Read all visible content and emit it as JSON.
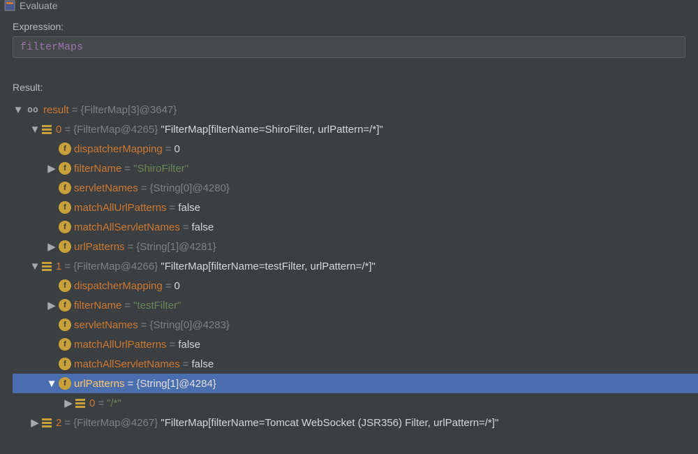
{
  "window": {
    "title": "Evaluate"
  },
  "expression": {
    "label": "Expression:",
    "value": "filterMaps"
  },
  "result": {
    "label": "Result:",
    "root": {
      "name": "result",
      "type": "{FilterMap[3]@3647}"
    },
    "items": [
      {
        "index": "0",
        "type": "{FilterMap@4265}",
        "summary": "\"FilterMap[filterName=ShiroFilter, urlPattern=/*]\"",
        "expanded": true,
        "fields": [
          {
            "name": "dispatcherMapping",
            "value": "0",
            "expandable": false,
            "valClass": "k-white"
          },
          {
            "name": "filterName",
            "value": "\"ShiroFilter\"",
            "expandable": true,
            "valClass": "k-str"
          },
          {
            "name": "servletNames",
            "value": "{String[0]@4280}",
            "expandable": false,
            "valClass": "k-gray"
          },
          {
            "name": "matchAllUrlPatterns",
            "value": "false",
            "expandable": false,
            "valClass": "k-white"
          },
          {
            "name": "matchAllServletNames",
            "value": "false",
            "expandable": false,
            "valClass": "k-white"
          },
          {
            "name": "urlPatterns",
            "value": "{String[1]@4281}",
            "expandable": true,
            "valClass": "k-gray"
          }
        ]
      },
      {
        "index": "1",
        "type": "{FilterMap@4266}",
        "summary": "\"FilterMap[filterName=testFilter, urlPattern=/*]\"",
        "expanded": true,
        "fields": [
          {
            "name": "dispatcherMapping",
            "value": "0",
            "expandable": false,
            "valClass": "k-white"
          },
          {
            "name": "filterName",
            "value": "\"testFilter\"",
            "expandable": true,
            "valClass": "k-str"
          },
          {
            "name": "servletNames",
            "value": "{String[0]@4283}",
            "expandable": false,
            "valClass": "k-gray"
          },
          {
            "name": "matchAllUrlPatterns",
            "value": "false",
            "expandable": false,
            "valClass": "k-white"
          },
          {
            "name": "matchAllServletNames",
            "value": "false",
            "expandable": false,
            "valClass": "k-white"
          },
          {
            "name": "urlPatterns",
            "value": "{String[1]@4284}",
            "expandable": true,
            "valClass": "k-gray",
            "selected": true,
            "expanded": true,
            "children": [
              {
                "index": "0",
                "value": "\"/*\"",
                "expandable": true
              }
            ]
          }
        ]
      },
      {
        "index": "2",
        "type": "{FilterMap@4267}",
        "summary": "\"FilterMap[filterName=Tomcat WebSocket (JSR356) Filter, urlPattern=/*]\"",
        "expanded": false
      }
    ]
  }
}
